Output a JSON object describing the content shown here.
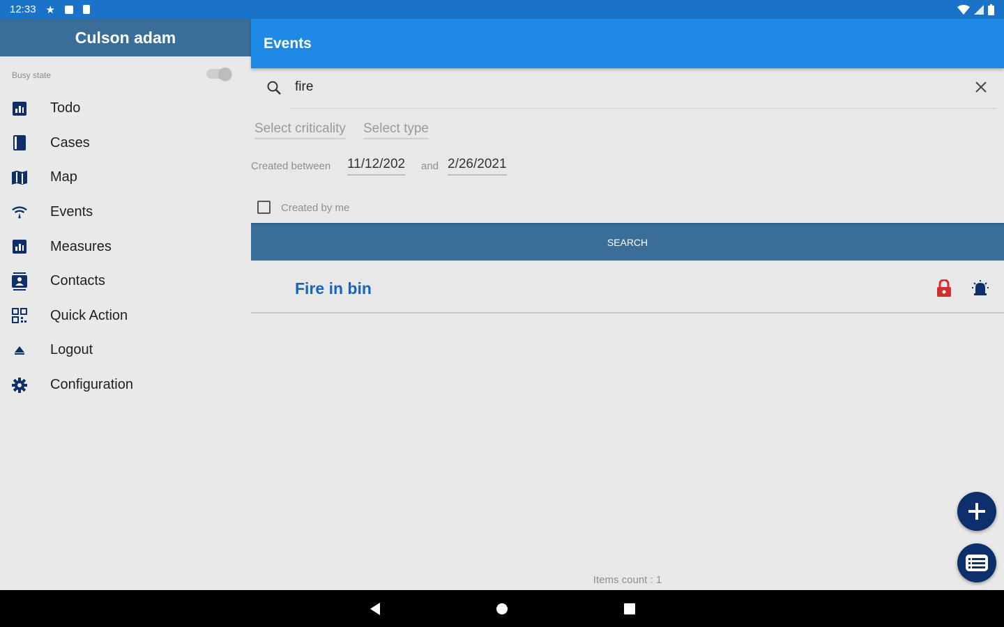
{
  "status_bar": {
    "time": "12:33"
  },
  "sidebar": {
    "title": "Culson adam",
    "busy_state_label": "Busy state",
    "items": [
      {
        "label": "Todo",
        "icon": "todo-icon"
      },
      {
        "label": "Cases",
        "icon": "cases-icon"
      },
      {
        "label": "Map",
        "icon": "map-icon"
      },
      {
        "label": "Events",
        "icon": "events-icon"
      },
      {
        "label": "Measures",
        "icon": "measures-icon"
      },
      {
        "label": "Contacts",
        "icon": "contacts-icon"
      },
      {
        "label": "Quick Action",
        "icon": "qr-code-icon"
      },
      {
        "label": "Logout",
        "icon": "logout-icon"
      },
      {
        "label": "Configuration",
        "icon": "gear-icon"
      }
    ]
  },
  "main": {
    "title": "Events",
    "search": {
      "value": "fire"
    },
    "filters": {
      "criticality_placeholder": "Select criticality",
      "type_placeholder": "Select type"
    },
    "dates": {
      "label": "Created between",
      "from": "11/12/202",
      "and_label": "and",
      "to": "2/26/2021"
    },
    "created_by_me_label": "Created by me",
    "search_button_label": "SEARCH",
    "results": [
      {
        "title": "Fire in bin"
      }
    ],
    "items_count_label": "Items count : 1"
  },
  "colors": {
    "statusbar": "#1a73c8",
    "topbar": "#1e88e5",
    "sidebar_header": "#3a6e99",
    "search_button": "#3a6e99",
    "fab": "#0d2f6b",
    "icon_navy": "#0d2f6b",
    "lock_red": "#d32f2f",
    "result_title": "#1565c0"
  }
}
